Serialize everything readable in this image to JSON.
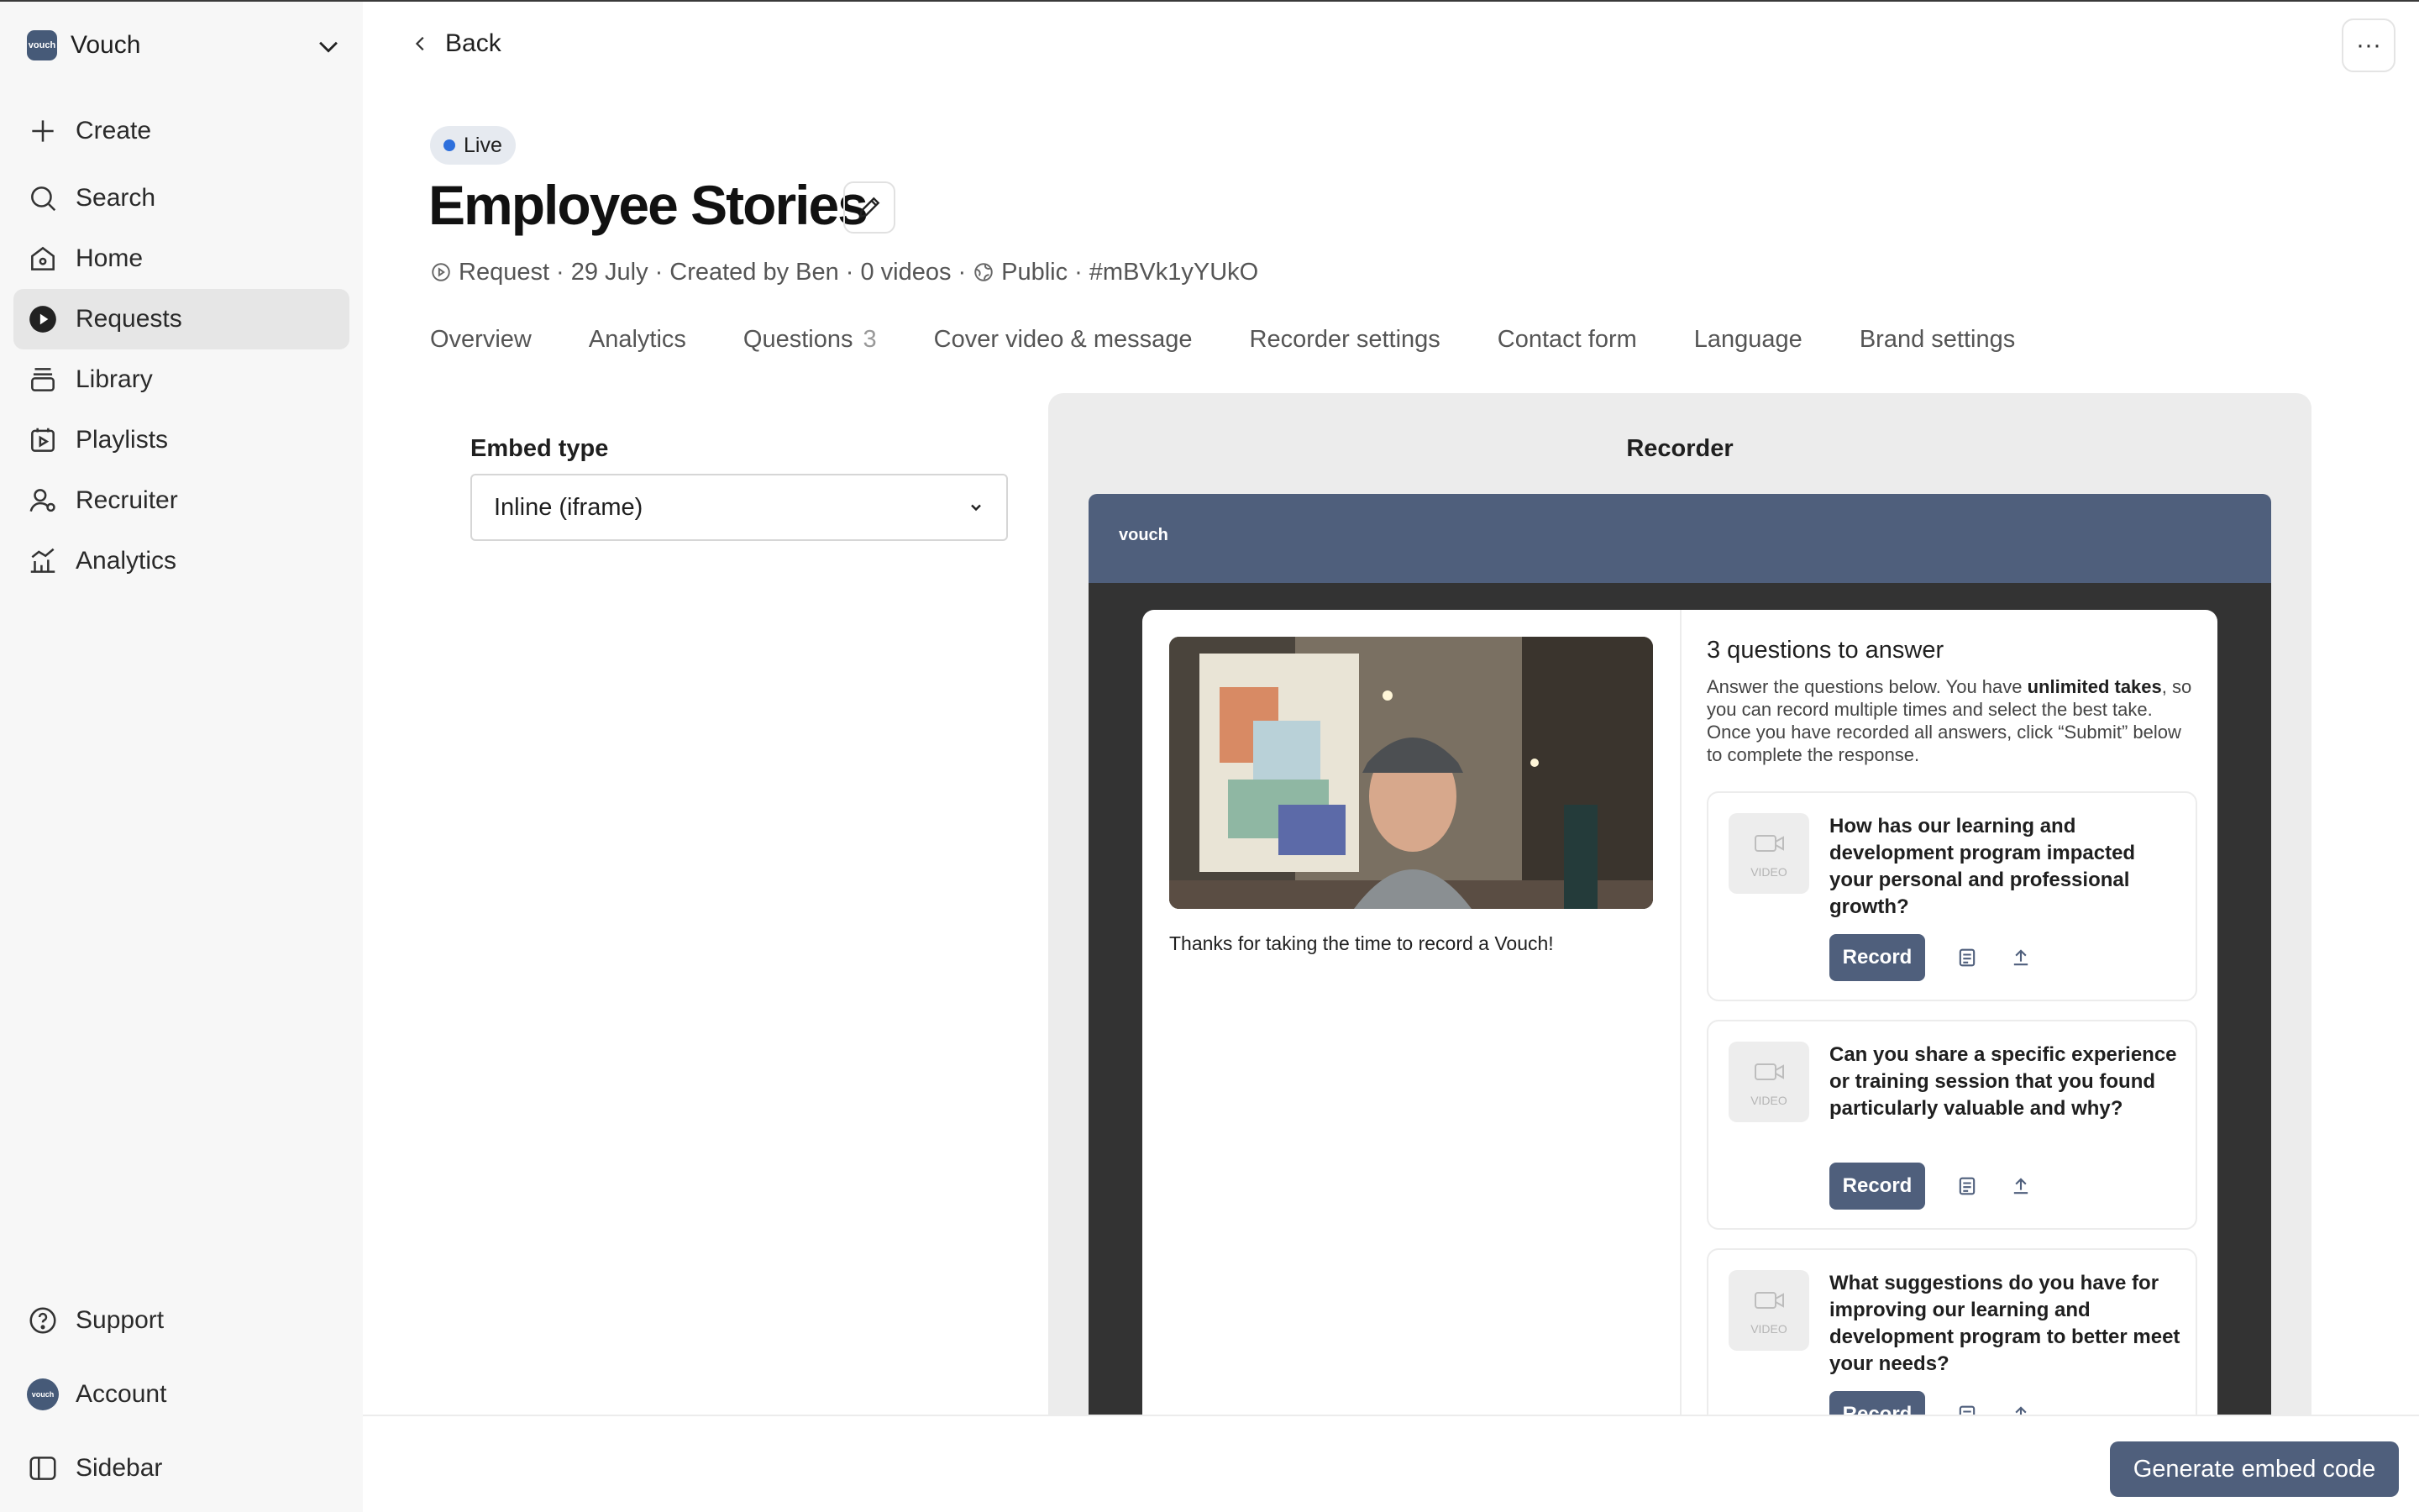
{
  "workspace": {
    "name": "Vouch",
    "logo_text": "vouch"
  },
  "sidebar": {
    "items": [
      {
        "label": "Create"
      },
      {
        "label": "Search"
      },
      {
        "label": "Home"
      },
      {
        "label": "Requests"
      },
      {
        "label": "Library"
      },
      {
        "label": "Playlists"
      },
      {
        "label": "Recruiter"
      },
      {
        "label": "Analytics"
      }
    ],
    "bottom": [
      {
        "label": "Support"
      },
      {
        "label": "Account"
      },
      {
        "label": "Sidebar"
      }
    ],
    "active": "Requests"
  },
  "header": {
    "back_label": "Back",
    "more_label": "···",
    "status": "Live",
    "title": "Employee Stories",
    "meta": {
      "type": "Request",
      "date": "29 July",
      "created_by": "Created by Ben",
      "videos": "0 videos",
      "visibility": "Public",
      "id": "#mBVk1yYUkO",
      "sep": "·"
    }
  },
  "tabs": [
    {
      "label": "Overview"
    },
    {
      "label": "Analytics"
    },
    {
      "label": "Questions",
      "count": "3"
    },
    {
      "label": "Cover video & message"
    },
    {
      "label": "Recorder settings"
    },
    {
      "label": "Contact form"
    },
    {
      "label": "Language"
    },
    {
      "label": "Brand settings"
    }
  ],
  "embed": {
    "label": "Embed type",
    "selected": "Inline (iframe)"
  },
  "preview": {
    "title": "Recorder",
    "logo_text": "vouch",
    "thanks": "Thanks for taking the time to record a Vouch!",
    "questions_heading": "3 questions to answer",
    "desc_before": "Answer the questions below. You have ",
    "desc_bold": "unlimited takes",
    "desc_after": ", so you can record multiple times and select the best take. Once you have recorded all answers, click “Submit” below to complete the response.",
    "thumb_label": "VIDEO",
    "record_label": "Record",
    "questions": [
      {
        "text": "How has our learning and development program impacted your personal and professional growth?"
      },
      {
        "text": "Can you share a specific experience or training session that you found particularly valuable and why?"
      },
      {
        "text": "What suggestions do you have for improving our learning and development program to better meet your needs?"
      }
    ]
  },
  "footer": {
    "generate_label": "Generate embed code"
  },
  "colors": {
    "accent": "#4f5f7c",
    "live_dot": "#2d6fdc",
    "active_nav": "#e6e6e6"
  }
}
